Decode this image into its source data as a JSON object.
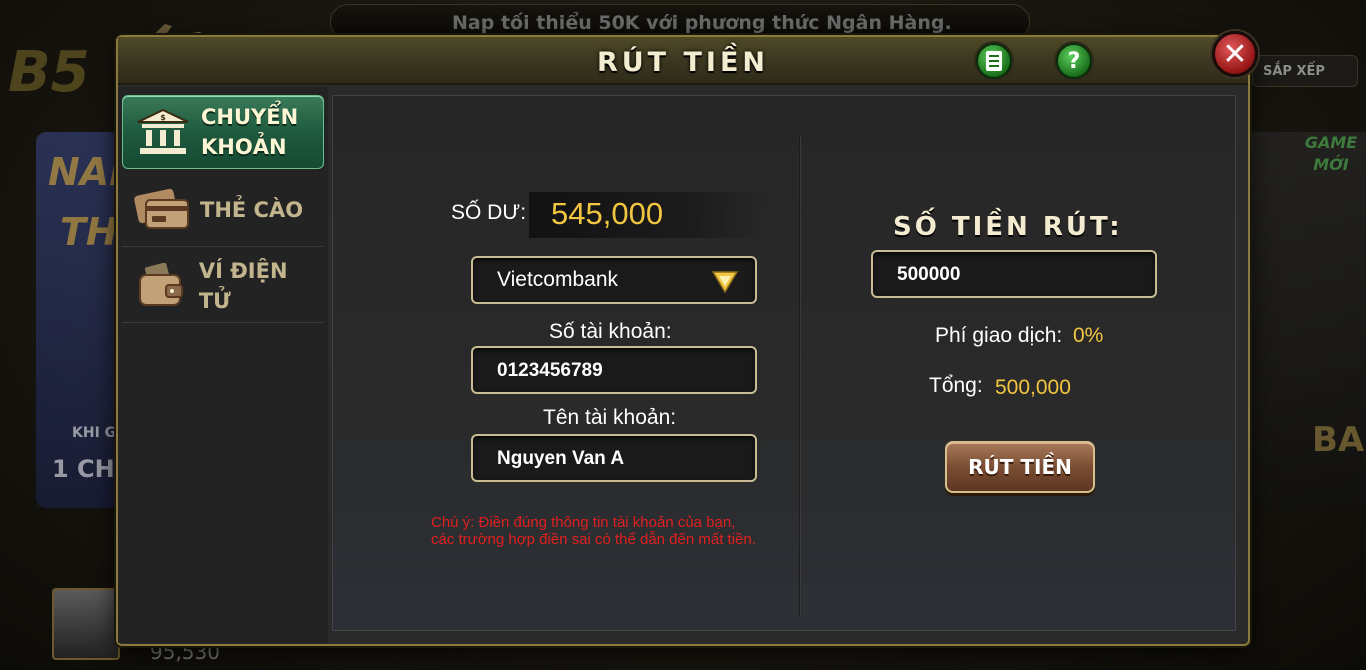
{
  "background": {
    "marquee": "Nap tối thiểu 50K với phương thức Ngân Hàng.",
    "sort_label": "SẮP XẾP",
    "logo_text": "B5",
    "left_banner_line1": "NAP",
    "left_banner_line2": "TH",
    "left_banner_line3": "KHI G",
    "left_banner_line4": "1 CH",
    "game_moi": "GAME MỚI",
    "right_banner_text": "BA",
    "coins": "95,530"
  },
  "modal": {
    "title": "RÚT TIỀN",
    "list_icon": "list-icon",
    "help_label": "?",
    "close_label": "✕"
  },
  "sidebar": {
    "items": [
      {
        "label_line1": "CHUYỂN",
        "label_line2": "KHOẢN",
        "icon": "bank-icon",
        "active": true
      },
      {
        "label": "THẺ CÀO",
        "icon": "card-icon",
        "active": false
      },
      {
        "label": "VÍ ĐIỆN TỬ",
        "icon": "wallet-icon",
        "active": false
      }
    ]
  },
  "form": {
    "balance_label": "SỐ DƯ:",
    "balance_value": "545,000",
    "bank_selected": "Vietcombank",
    "account_number_label": "Số tài khoản:",
    "account_number_value": "0123456789",
    "account_name_label": "Tên tài khoản:",
    "account_name_value": "Nguyen Van A",
    "warning_line1": "Chú ý: Điền đúng thông tin tài khoản của bạn,",
    "warning_line2": "các trường hợp điền sai có thể dẫn đến mất tiền."
  },
  "withdraw": {
    "amount_title": "SỐ TIỀN RÚT:",
    "amount_value": "500000",
    "fee_label": "Phí giao dịch:",
    "fee_value": "0%",
    "total_label": "Tổng:",
    "total_value": "500,000",
    "submit_label": "RÚT TIỀN"
  },
  "colors": {
    "gold": "#f2c640",
    "warning": "#e02020",
    "active_tab": "#1f5a3e",
    "close": "#9b1919"
  }
}
